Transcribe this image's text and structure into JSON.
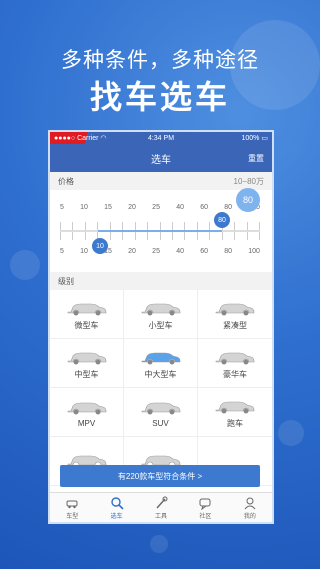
{
  "promo": {
    "subtitle": "多种条件，多种途径",
    "title": "找车选车"
  },
  "status_bar": {
    "carrier": "●●●●○ Carrier ",
    "time": "4:34 PM",
    "battery": "100%"
  },
  "nav": {
    "title": "选车",
    "reset": "重置"
  },
  "price": {
    "label": "价格",
    "range_label": "10−80万",
    "ticks": [
      "5",
      "10",
      "15",
      "20",
      "25",
      "40",
      "60",
      "80",
      "100"
    ],
    "low_value": "10",
    "high_value": "80",
    "bubble_value": "80"
  },
  "level": {
    "label": "级别",
    "types": [
      {
        "label": "微型车",
        "icon": "mini-car-icon"
      },
      {
        "label": "小型车",
        "icon": "small-car-icon"
      },
      {
        "label": "紧凑型",
        "icon": "compact-car-icon"
      },
      {
        "label": "中型车",
        "icon": "midsize-car-icon"
      },
      {
        "label": "中大型车",
        "icon": "large-car-icon"
      },
      {
        "label": "豪华车",
        "icon": "luxury-car-icon"
      },
      {
        "label": "MPV",
        "icon": "mpv-icon"
      },
      {
        "label": "SUV",
        "icon": "suv-icon"
      },
      {
        "label": "跑车",
        "icon": "sports-car-icon"
      }
    ]
  },
  "result_button": "有220款车型符合条件 >",
  "tabs": [
    {
      "label": "车型",
      "icon": "car-icon"
    },
    {
      "label": "选车",
      "icon": "search-icon"
    },
    {
      "label": "工具",
      "icon": "tools-icon"
    },
    {
      "label": "社区",
      "icon": "chat-icon"
    },
    {
      "label": "我的",
      "icon": "user-icon"
    }
  ],
  "colors": {
    "accent": "#3c79cf",
    "selected_car": "#5aa2ea"
  }
}
